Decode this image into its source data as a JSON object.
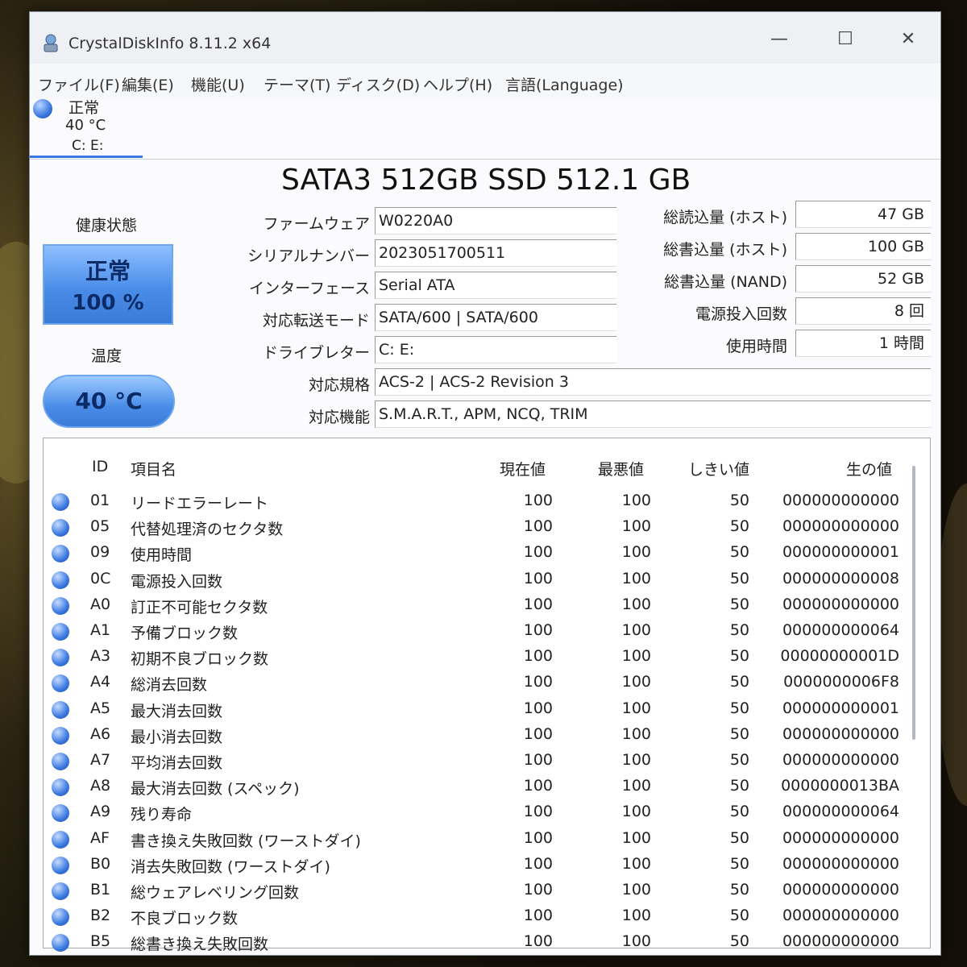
{
  "window": {
    "title": "CrystalDiskInfo 8.11.2 x64",
    "minimize": "—",
    "maximize": "☐",
    "close": "✕"
  },
  "menu": [
    "ファイル(F)",
    "編集(E)",
    "機能(U)",
    "テーマ(T)",
    "ディスク(D)",
    "ヘルプ(H)",
    "言語(Language)"
  ],
  "drive_tab": {
    "status": "正常",
    "temp": "40 °C",
    "letters": "C: E:"
  },
  "model": "SATA3 512GB SSD 512.1 GB",
  "health": {
    "label": "健康状態",
    "status": "正常",
    "percent": "100 %"
  },
  "temperature": {
    "label": "温度",
    "value": "40 °C"
  },
  "info": {
    "firmware": {
      "label": "ファームウェア",
      "value": "W0220A0"
    },
    "serial": {
      "label": "シリアルナンバー",
      "value": "2023051700511"
    },
    "interface": {
      "label": "インターフェース",
      "value": "Serial ATA"
    },
    "transfer": {
      "label": "対応転送モード",
      "value": "SATA/600 | SATA/600"
    },
    "drive_letter": {
      "label": "ドライブレター",
      "value": "C: E:"
    },
    "standard": {
      "label": "対応規格",
      "value": "ACS-2 | ACS-2 Revision 3"
    },
    "features": {
      "label": "対応機能",
      "value": "S.M.A.R.T., APM, NCQ, TRIM"
    }
  },
  "stats": {
    "host_reads": {
      "label": "総読込量 (ホスト)",
      "value": "47 GB"
    },
    "host_writes": {
      "label": "総書込量 (ホスト)",
      "value": "100 GB"
    },
    "nand_writes": {
      "label": "総書込量 (NAND)",
      "value": "52 GB"
    },
    "power_on_count": {
      "label": "電源投入回数",
      "value": "8 回"
    },
    "power_on_hours": {
      "label": "使用時間",
      "value": "1 時間"
    }
  },
  "table": {
    "headers": {
      "id": "ID",
      "name": "項目名",
      "current": "現在値",
      "worst": "最悪値",
      "threshold": "しきい値",
      "raw": "生の値"
    },
    "rows": [
      {
        "id": "01",
        "name": "リードエラーレート",
        "current": "100",
        "worst": "100",
        "threshold": "50",
        "raw": "000000000000"
      },
      {
        "id": "05",
        "name": "代替処理済のセクタ数",
        "current": "100",
        "worst": "100",
        "threshold": "50",
        "raw": "000000000000"
      },
      {
        "id": "09",
        "name": "使用時間",
        "current": "100",
        "worst": "100",
        "threshold": "50",
        "raw": "000000000001"
      },
      {
        "id": "0C",
        "name": "電源投入回数",
        "current": "100",
        "worst": "100",
        "threshold": "50",
        "raw": "000000000008"
      },
      {
        "id": "A0",
        "name": "訂正不可能セクタ数",
        "current": "100",
        "worst": "100",
        "threshold": "50",
        "raw": "000000000000"
      },
      {
        "id": "A1",
        "name": "予備ブロック数",
        "current": "100",
        "worst": "100",
        "threshold": "50",
        "raw": "000000000064"
      },
      {
        "id": "A3",
        "name": "初期不良ブロック数",
        "current": "100",
        "worst": "100",
        "threshold": "50",
        "raw": "00000000001D"
      },
      {
        "id": "A4",
        "name": "総消去回数",
        "current": "100",
        "worst": "100",
        "threshold": "50",
        "raw": "0000000006F8"
      },
      {
        "id": "A5",
        "name": "最大消去回数",
        "current": "100",
        "worst": "100",
        "threshold": "50",
        "raw": "000000000001"
      },
      {
        "id": "A6",
        "name": "最小消去回数",
        "current": "100",
        "worst": "100",
        "threshold": "50",
        "raw": "000000000000"
      },
      {
        "id": "A7",
        "name": "平均消去回数",
        "current": "100",
        "worst": "100",
        "threshold": "50",
        "raw": "000000000000"
      },
      {
        "id": "A8",
        "name": "最大消去回数 (スペック)",
        "current": "100",
        "worst": "100",
        "threshold": "50",
        "raw": "0000000013BA"
      },
      {
        "id": "A9",
        "name": "残り寿命",
        "current": "100",
        "worst": "100",
        "threshold": "50",
        "raw": "000000000064"
      },
      {
        "id": "AF",
        "name": "書き換え失敗回数 (ワーストダイ)",
        "current": "100",
        "worst": "100",
        "threshold": "50",
        "raw": "000000000000"
      },
      {
        "id": "B0",
        "name": "消去失敗回数 (ワーストダイ)",
        "current": "100",
        "worst": "100",
        "threshold": "50",
        "raw": "000000000000"
      },
      {
        "id": "B1",
        "name": "総ウェアレベリング回数",
        "current": "100",
        "worst": "100",
        "threshold": "50",
        "raw": "000000000000"
      },
      {
        "id": "B2",
        "name": "不良ブロック数",
        "current": "100",
        "worst": "100",
        "threshold": "50",
        "raw": "000000000000"
      },
      {
        "id": "B5",
        "name": "総書き換え失敗回数",
        "current": "100",
        "worst": "100",
        "threshold": "50",
        "raw": "000000000000"
      }
    ]
  }
}
